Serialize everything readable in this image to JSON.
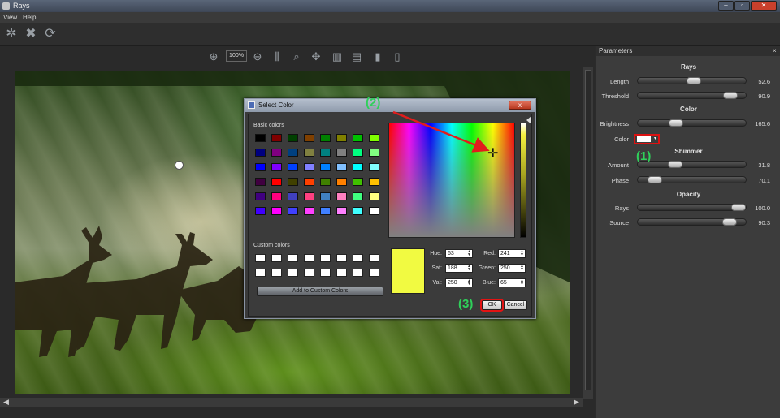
{
  "window": {
    "title": "Rays"
  },
  "menu": [
    "View",
    "Help"
  ],
  "viewbar": {
    "zoom": "100%"
  },
  "params_panel": {
    "title": "Parameters",
    "close": "×",
    "sections": {
      "rays": "Rays",
      "color": "Color",
      "shimmer": "Shimmer",
      "opacity": "Opacity"
    },
    "length": {
      "label": "Length",
      "value": "52.6",
      "level": 0.526
    },
    "threshold": {
      "label": "Threshold",
      "value": "90.9",
      "level": 0.909
    },
    "brightness": {
      "label": "Brightness",
      "value": "165.6",
      "level": 0.33
    },
    "color": {
      "label": "Color",
      "value": "#ffffff"
    },
    "amount": {
      "label": "Amount",
      "value": "31.8",
      "level": 0.318
    },
    "phase": {
      "label": "Phase",
      "value": "70.1",
      "level": 0.1
    },
    "opacity_rays": {
      "label": "Rays",
      "value": "100.0",
      "level": 1.0
    },
    "source": {
      "label": "Source",
      "value": "90.3",
      "level": 0.903
    }
  },
  "annotations": {
    "one": "(1)",
    "two": "(2)",
    "three": "(3)"
  },
  "dialog": {
    "title": "Select Color",
    "close": "x",
    "basic_colors_label": "Basic colors",
    "custom_colors_label": "Custom colors",
    "add_custom": "Add to Custom Colors",
    "basic_colors": [
      [
        "#000000",
        "#800000",
        "#004000",
        "#804000",
        "#008000",
        "#808000",
        "#00c000",
        "#80ff00"
      ],
      [
        "#000080",
        "#800080",
        "#004080",
        "#808040",
        "#008080",
        "#808080",
        "#00ff80",
        "#80ff80"
      ],
      [
        "#0000ff",
        "#8000ff",
        "#0040ff",
        "#8080ff",
        "#0080ff",
        "#80c0ff",
        "#00ffff",
        "#80ffff"
      ],
      [
        "#400040",
        "#ff0000",
        "#404000",
        "#ff4000",
        "#408000",
        "#ff8000",
        "#40c000",
        "#ffc000"
      ],
      [
        "#400080",
        "#ff0080",
        "#4040c0",
        "#ff4080",
        "#4080c0",
        "#ff80c0",
        "#40ff80",
        "#ffff80"
      ],
      [
        "#4000ff",
        "#ff00ff",
        "#4040ff",
        "#ff40ff",
        "#4080ff",
        "#ff80ff",
        "#40ffff",
        "#ffffff"
      ]
    ],
    "fields": {
      "hue": {
        "label": "Hue:",
        "value": "63"
      },
      "sat": {
        "label": "Sat:",
        "value": "188"
      },
      "val": {
        "label": "Val:",
        "value": "250"
      },
      "red": {
        "label": "Red:",
        "value": "241"
      },
      "green": {
        "label": "Green:",
        "value": "250"
      },
      "blue": {
        "label": "Blue:",
        "value": "65"
      }
    },
    "preview_color": "#f1fa41",
    "ok": "OK",
    "cancel": "Cancel"
  }
}
